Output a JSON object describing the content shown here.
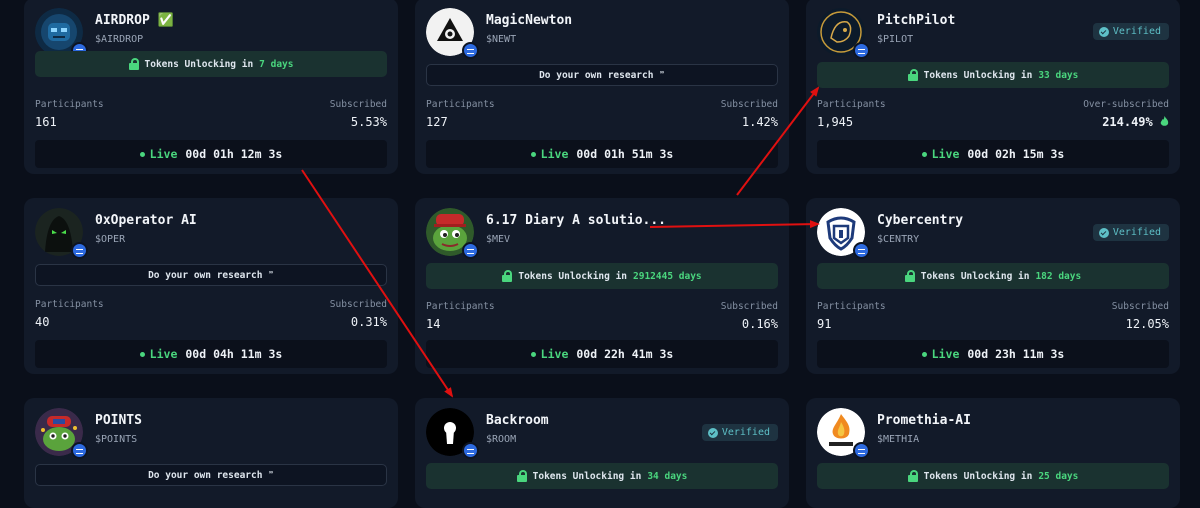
{
  "colors": {
    "page_bg": "#0a0f1a",
    "card_bg": "#121a29",
    "accent_green": "#4ad67e",
    "verified_teal": "#5ec0c7",
    "annotation_red": "#e01010"
  },
  "cards": [
    {
      "name": "AIRDROP ✅",
      "ticker": "$AIRDROP",
      "verified": "",
      "banner_type": "unlock",
      "banner_prefix": "Tokens Unlocking in",
      "banner_days": "7 days",
      "participants_label": "Participants",
      "participants": "161",
      "subscribed_label": "Subscribed",
      "subscribed": "5.53%",
      "status": "Live",
      "timer": "00d 01h 12m 3s",
      "avatar_icon": "robot-icon"
    },
    {
      "name": "MagicNewton",
      "ticker": "$NEWT",
      "verified": "",
      "banner_type": "dyor",
      "banner_text": "Do your own research ❞",
      "participants_label": "Participants",
      "participants": "127",
      "subscribed_label": "Subscribed",
      "subscribed": "1.42%",
      "status": "Live",
      "timer": "00d 01h 51m 3s",
      "avatar_icon": "triangle-logo-icon"
    },
    {
      "name": "PitchPilot",
      "ticker": "$PILOT",
      "verified": "Verified",
      "banner_type": "unlock",
      "banner_prefix": "Tokens Unlocking in",
      "banner_days": "33 days",
      "participants_label": "Participants",
      "participants": "1,945",
      "subscribed_label": "Over-subscribed",
      "subscribed": "214.49%",
      "subscribed_highlight": true,
      "status": "Live",
      "timer": "00d 02h 15m 3s",
      "avatar_icon": "lion-icon"
    },
    {
      "name": "0xOperator AI",
      "ticker": "$OPER",
      "verified": "",
      "banner_type": "dyor",
      "banner_text": "Do your own research ❞",
      "participants_label": "Participants",
      "participants": "40",
      "subscribed_label": "Subscribed",
      "subscribed": "0.31%",
      "status": "Live",
      "timer": "00d 04h 11m 3s",
      "avatar_icon": "hooded-figure-icon"
    },
    {
      "name": "6.17 Diary A solutio...",
      "ticker": "$MEV",
      "verified": "",
      "banner_type": "unlock",
      "banner_prefix": "Tokens Unlocking in",
      "banner_days": "2912445 days",
      "participants_label": "Participants",
      "participants": "14",
      "subscribed_label": "Subscribed",
      "subscribed": "0.16%",
      "status": "Live",
      "timer": "00d 22h 41m 3s",
      "avatar_icon": "frog-icon"
    },
    {
      "name": "Cybercentry",
      "ticker": "$CENTRY",
      "verified": "Verified",
      "banner_type": "unlock",
      "banner_prefix": "Tokens Unlocking in",
      "banner_days": "182 days",
      "participants_label": "Participants",
      "participants": "91",
      "subscribed_label": "Subscribed",
      "subscribed": "12.05%",
      "status": "Live",
      "timer": "00d 23h 11m 3s",
      "avatar_icon": "shield-logo-icon"
    },
    {
      "name": "POINTS",
      "ticker": "$POINTS",
      "verified": "",
      "banner_type": "dyor",
      "banner_text": "Do your own research ❞",
      "avatar_icon": "frog-cap-icon"
    },
    {
      "name": "Backroom",
      "ticker": "$ROOM",
      "verified": "Verified",
      "banner_type": "unlock",
      "banner_prefix": "Tokens Unlocking in",
      "banner_days": "34 days",
      "avatar_icon": "keyhole-icon"
    },
    {
      "name": "Promethia-AI",
      "ticker": "$METHIA",
      "verified": "",
      "banner_type": "unlock",
      "banner_prefix": "Tokens Unlocking in",
      "banner_days": "25 days",
      "avatar_icon": "flame-logo-icon"
    }
  ]
}
